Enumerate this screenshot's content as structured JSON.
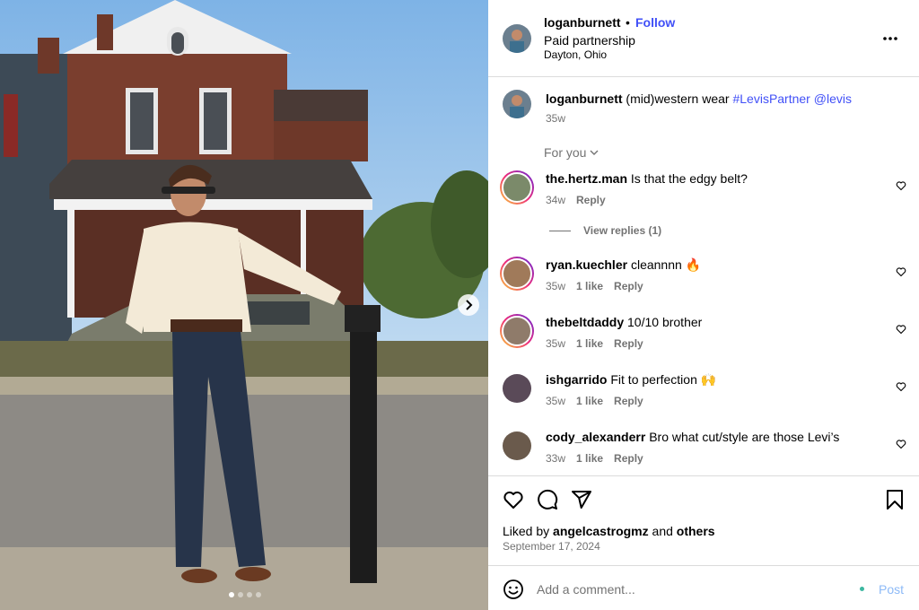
{
  "post": {
    "author": "loganburnett",
    "separator": "•",
    "follow_label": "Follow",
    "partnership": "Paid partnership",
    "location": "Dayton, Ohio"
  },
  "caption": {
    "user": "loganburnett",
    "text": " (mid)western wear ",
    "hashtag": "#LevisPartner",
    "mention": "@levis",
    "time": "35w"
  },
  "for_you_label": "For you",
  "comments": [
    {
      "user": "the.hertz.man",
      "text": "Is that the edgy belt?",
      "time": "34w",
      "likes": "",
      "reply": "Reply"
    },
    {
      "user": "ryan.kuechler",
      "text": "cleannnn 🔥",
      "time": "35w",
      "likes": "1 like",
      "reply": "Reply"
    },
    {
      "user": "thebeltdaddy",
      "text": "10/10 brother",
      "time": "35w",
      "likes": "1 like",
      "reply": "Reply"
    },
    {
      "user": "ishgarrido",
      "text": "Fit to perfection 🙌",
      "time": "35w",
      "likes": "1 like",
      "reply": "Reply"
    },
    {
      "user": "cody_alexanderr",
      "text": "Bro what cut/style are those Levi’s",
      "time": "33w",
      "likes": "1 like",
      "reply": "Reply"
    }
  ],
  "view_replies": "View replies (1)",
  "likes": {
    "prefix": "Liked by ",
    "user": "angelcastrogmz",
    "middle": " and ",
    "others": "others"
  },
  "date": "September 17, 2024",
  "composer": {
    "placeholder": "Add a comment...",
    "post_label": "Post"
  },
  "colors": {
    "link": "#4150f7",
    "muted": "#737373",
    "border": "#dbdbdb",
    "post_disabled": "#8dbaf7"
  },
  "carousel": {
    "slides": 4,
    "active": 1
  },
  "icons": [
    "more-icon",
    "heart-icon",
    "comment-icon",
    "share-icon",
    "bookmark-icon",
    "emoji-icon",
    "chevron-right-icon",
    "chevron-down-icon"
  ]
}
